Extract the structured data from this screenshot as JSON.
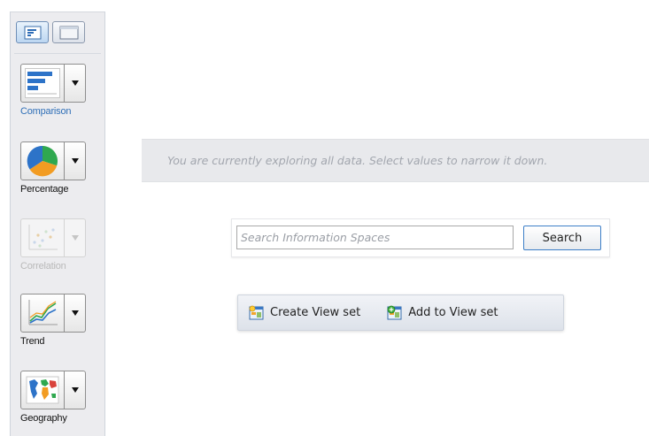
{
  "palette": {
    "charts": [
      {
        "label": "Comparison",
        "icon": "bar-chart-icon",
        "state": "selected"
      },
      {
        "label": "Percentage",
        "icon": "pie-chart-icon",
        "state": "enabled"
      },
      {
        "label": "Correlation",
        "icon": "scatter-chart-icon",
        "state": "disabled"
      },
      {
        "label": "Trend",
        "icon": "line-chart-icon",
        "state": "enabled"
      },
      {
        "label": "Geography",
        "icon": "map-icon",
        "state": "enabled"
      }
    ]
  },
  "banner": {
    "text": "You are currently exploring all data. Select values to narrow it down."
  },
  "search": {
    "placeholder": "Search Information Spaces",
    "value": "",
    "button_label": "Search"
  },
  "viewset": {
    "create_label": "Create View set",
    "add_label": "Add to View set"
  },
  "colors": {
    "accent": "#2f6fb7",
    "search_border": "#3d7fc8",
    "banner_bg": "#e8e9ec",
    "banner_text": "#a2a6ae"
  }
}
